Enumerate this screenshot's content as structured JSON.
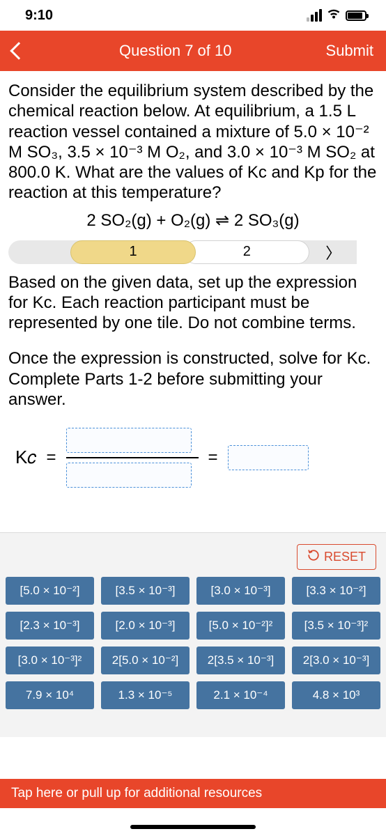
{
  "status": {
    "time": "9:10"
  },
  "header": {
    "title": "Question 7 of 10",
    "submit": "Submit"
  },
  "question": {
    "prompt_html": "Consider the equilibrium system described by the chemical reaction below. At equilibrium, a 1.5 L reaction vessel contained a mixture of 5.0 × 10⁻² M SO₃, 3.5 × 10⁻³ M O₂, and 3.0 × 10⁻³ M SO₂ at 800.0 K. What are the values of Kc and Kp for the reaction at this temperature?",
    "equation_html": "2 SO₂(g) + O₂(g) ⇌ 2 SO₃(g)"
  },
  "tabs": {
    "step1": "1",
    "step2": "2",
    "arrow": "〉"
  },
  "instruction1": "Based on the given data, set up the expression for Kc. Each reaction participant must be represented by one tile. Do not combine terms.",
  "instruction2": "Once the expression is constructed, solve for Kc. Complete Parts 1-2 before submitting your answer.",
  "kc": {
    "label_html": "K𝑐",
    "equals1": "=",
    "equals2": "="
  },
  "reset": "RESET",
  "tiles": [
    "[5.0 × 10⁻²]",
    "[3.5 × 10⁻³]",
    "[3.0 × 10⁻³]",
    "[3.3 × 10⁻²]",
    "[2.3 × 10⁻³]",
    "[2.0 × 10⁻³]",
    "[5.0 × 10⁻²]²",
    "[3.5 × 10⁻³]²",
    "[3.0 × 10⁻³]²",
    "2[5.0 × 10⁻²]",
    "2[3.5 × 10⁻³]",
    "2[3.0 × 10⁻³]",
    "7.9 × 10⁴",
    "1.3 × 10⁻⁵",
    "2.1 × 10⁻⁴",
    "4.8 × 10³"
  ],
  "footer": "Tap here or pull up for additional resources"
}
